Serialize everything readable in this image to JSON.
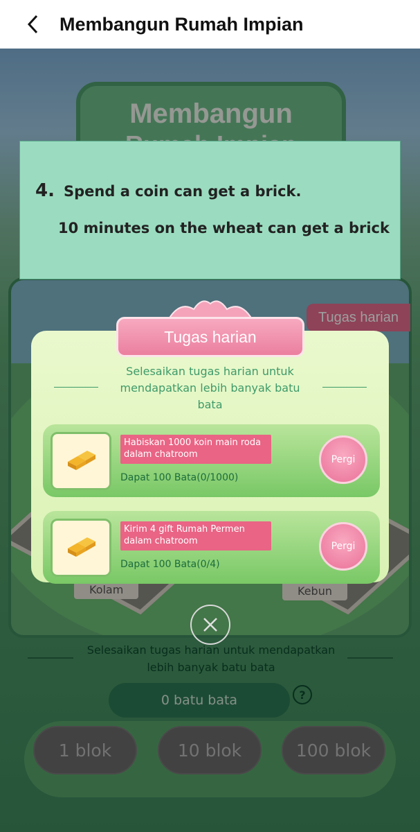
{
  "header": {
    "title": "Membangun Rumah Impian"
  },
  "banner": {
    "line1": "Membangun",
    "line2": "Rumah Impian"
  },
  "instruction": {
    "number": "4.",
    "line1": "Spend a coin can get a brick.",
    "line2": "10 minutes on the wheat can get a brick"
  },
  "side_tab": {
    "label": "Tugas harian"
  },
  "popup": {
    "title": "Tugas harian",
    "subtitle_lines": [
      "Selesaikan tugas harian untuk",
      "mendapatkan lebih banyak batu",
      "bata"
    ],
    "tasks": [
      {
        "label_lines": [
          "Habiskan 1000 koin main roda",
          "dalam chatroom"
        ],
        "reward": "Dapat 100 Bata(0/1000)",
        "button": "Pergi"
      },
      {
        "label_lines": [
          "Kirim 4 gift Rumah Permen",
          "dalam chatroom"
        ],
        "reward": "Dapat 100 Bata(0/4)",
        "button": "Pergi"
      }
    ]
  },
  "scene_tags": {
    "pond": "Kolam",
    "garden": "Kebun"
  },
  "bottom": {
    "desc_line1": "Selesaikan tugas harian untuk mendapatkan",
    "desc_line2": "lebih banyak batu bata",
    "brick_count": "0 batu bata",
    "help": "?",
    "block_buttons": [
      "1 blok",
      "10 blok",
      "100 blok"
    ]
  },
  "icons": {
    "back": "chevron-left-icon",
    "close": "close-icon",
    "help": "question-circle-icon",
    "gold": "gold-bar-icon"
  },
  "colors": {
    "accent_pink": "#e96485",
    "popup_green": "#79c866",
    "instruction_bg": "#9bdcc0",
    "text_green": "#1d6c3d"
  }
}
